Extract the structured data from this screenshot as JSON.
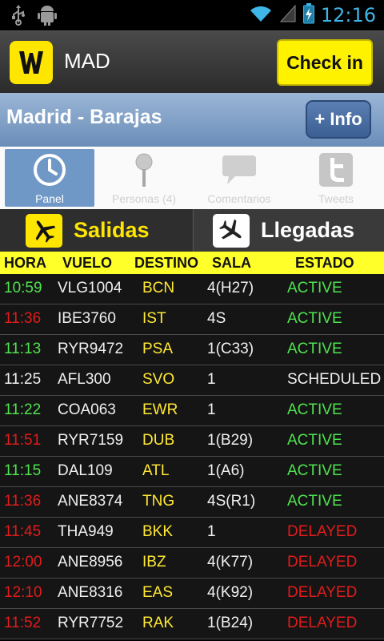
{
  "status_bar": {
    "time": "12:16"
  },
  "header": {
    "airport_code": "MAD",
    "checkin_label": "Check in"
  },
  "airport": {
    "name": "Madrid - Barajas",
    "info_label": "+ Info"
  },
  "tabs": [
    {
      "label": "Panel",
      "icon": "clock-icon",
      "active": true
    },
    {
      "label": "Personas (4)",
      "icon": "location-pin-icon",
      "active": false
    },
    {
      "label": "Comentarios",
      "icon": "speech-bubble-icon",
      "active": false
    },
    {
      "label": "Tweets",
      "icon": "twitter-icon",
      "active": false
    }
  ],
  "toggle": {
    "departures": "Salidas",
    "arrivals": "Llegadas"
  },
  "table": {
    "headers": {
      "time": "HORA",
      "flight": "VUELO",
      "destination": "DESTINO",
      "gate": "SALA",
      "status": "ESTADO"
    },
    "rows": [
      {
        "time": "10:59",
        "time_color": "green",
        "flight": "VLG1004",
        "dest": "BCN",
        "gate": "4(H27)",
        "status": "ACTIVE",
        "status_color": "green"
      },
      {
        "time": "11:36",
        "time_color": "red",
        "flight": "IBE3760",
        "dest": "IST",
        "gate": "4S",
        "status": "ACTIVE",
        "status_color": "green"
      },
      {
        "time": "11:13",
        "time_color": "green",
        "flight": "RYR9472",
        "dest": "PSA",
        "gate": "1(C33)",
        "status": "ACTIVE",
        "status_color": "green"
      },
      {
        "time": "11:25",
        "time_color": "white",
        "flight": "AFL300",
        "dest": "SVO",
        "gate": "1",
        "status": "SCHEDULED",
        "status_color": "white"
      },
      {
        "time": "11:22",
        "time_color": "green",
        "flight": "COA063",
        "dest": "EWR",
        "gate": "1",
        "status": "ACTIVE",
        "status_color": "green"
      },
      {
        "time": "11:51",
        "time_color": "red",
        "flight": "RYR7159",
        "dest": "DUB",
        "gate": "1(B29)",
        "status": "ACTIVE",
        "status_color": "green"
      },
      {
        "time": "11:15",
        "time_color": "green",
        "flight": "DAL109",
        "dest": "ATL",
        "gate": "1(A6)",
        "status": "ACTIVE",
        "status_color": "green"
      },
      {
        "time": "11:36",
        "time_color": "red",
        "flight": "ANE8374",
        "dest": "TNG",
        "gate": "4S(R1)",
        "status": "ACTIVE",
        "status_color": "green"
      },
      {
        "time": "11:45",
        "time_color": "red",
        "flight": "THA949",
        "dest": "BKK",
        "gate": "1",
        "status": "DELAYED",
        "status_color": "red"
      },
      {
        "time": "12:00",
        "time_color": "red",
        "flight": "ANE8956",
        "dest": "IBZ",
        "gate": "4(K77)",
        "status": "DELAYED",
        "status_color": "red"
      },
      {
        "time": "12:10",
        "time_color": "red",
        "flight": "ANE8316",
        "dest": "EAS",
        "gate": "4(K92)",
        "status": "DELAYED",
        "status_color": "red"
      },
      {
        "time": "11:52",
        "time_color": "red",
        "flight": "RYR7752",
        "dest": "RAK",
        "gate": "1(B24)",
        "status": "DELAYED",
        "status_color": "red"
      }
    ]
  },
  "colors": {
    "accent_yellow": "#ffe600",
    "header_yellow": "#ffff2a",
    "status_green": "#4fe34f",
    "status_red": "#e21b1b",
    "time_blue": "#3fb6e8"
  }
}
